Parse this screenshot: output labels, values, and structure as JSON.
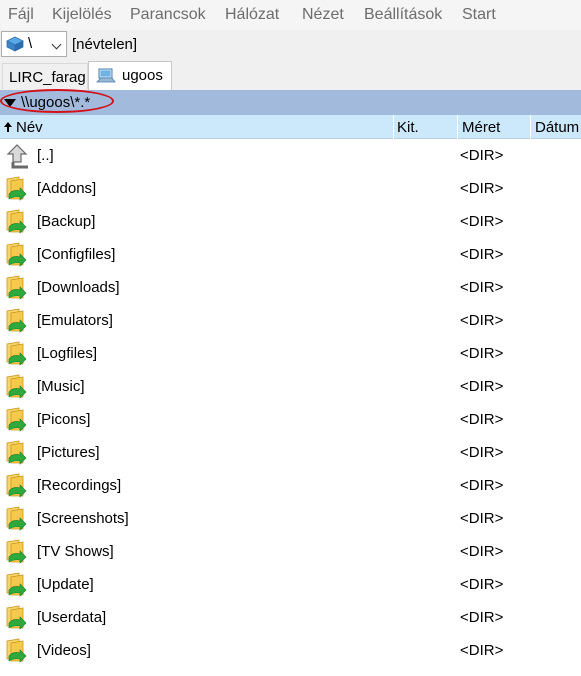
{
  "menu": [
    "Fájl",
    "Kijelölés",
    "Parancsok",
    "Hálózat",
    "Nézet",
    "Beállítások",
    "Start"
  ],
  "drive": {
    "letter": "\\",
    "volume_label": "[névtelen]",
    "icon": "network-drive-icon"
  },
  "tabs": [
    {
      "label": "LIRC_farag",
      "active": false
    },
    {
      "label": "ugoos",
      "active": true,
      "icon": "network-computer-icon"
    }
  ],
  "path": {
    "text": "\\\\ugoos\\*.*",
    "highlight_color": "#d0101a"
  },
  "columns": {
    "name": "Név",
    "ext": "Kit.",
    "size": "Méret",
    "date": "Dátum"
  },
  "files": [
    {
      "name": "[..]",
      "size": "<DIR>",
      "icon": "up-arrow-icon"
    },
    {
      "name": "[Addons]",
      "size": "<DIR>",
      "icon": "shared-folder-icon"
    },
    {
      "name": "[Backup]",
      "size": "<DIR>",
      "icon": "shared-folder-icon"
    },
    {
      "name": "[Configfiles]",
      "size": "<DIR>",
      "icon": "shared-folder-icon"
    },
    {
      "name": "[Downloads]",
      "size": "<DIR>",
      "icon": "shared-folder-icon"
    },
    {
      "name": "[Emulators]",
      "size": "<DIR>",
      "icon": "shared-folder-icon"
    },
    {
      "name": "[Logfiles]",
      "size": "<DIR>",
      "icon": "shared-folder-icon"
    },
    {
      "name": "[Music]",
      "size": "<DIR>",
      "icon": "shared-folder-icon"
    },
    {
      "name": "[Picons]",
      "size": "<DIR>",
      "icon": "shared-folder-icon"
    },
    {
      "name": "[Pictures]",
      "size": "<DIR>",
      "icon": "shared-folder-icon"
    },
    {
      "name": "[Recordings]",
      "size": "<DIR>",
      "icon": "shared-folder-icon"
    },
    {
      "name": "[Screenshots]",
      "size": "<DIR>",
      "icon": "shared-folder-icon"
    },
    {
      "name": "[TV Shows]",
      "size": "<DIR>",
      "icon": "shared-folder-icon"
    },
    {
      "name": "[Update]",
      "size": "<DIR>",
      "icon": "shared-folder-icon"
    },
    {
      "name": "[Userdata]",
      "size": "<DIR>",
      "icon": "shared-folder-icon"
    },
    {
      "name": "[Videos]",
      "size": "<DIR>",
      "icon": "shared-folder-icon"
    }
  ],
  "colors": {
    "path_bar": "#a2bbdc",
    "header_bar": "#cce8fb",
    "folder_yellow": "#f6c94d",
    "share_green": "#2eaa3c"
  }
}
